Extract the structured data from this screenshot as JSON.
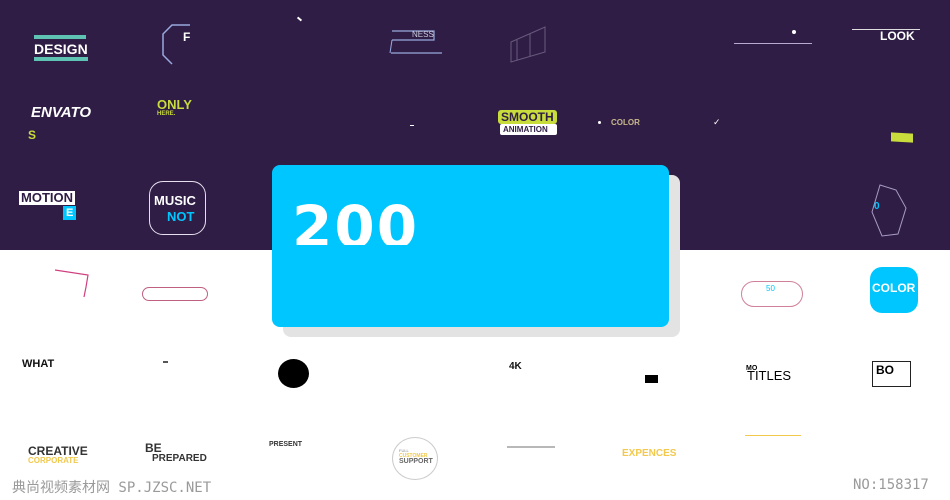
{
  "colors": {
    "background_top": "#2f1d45",
    "accent_blue": "#00c6ff",
    "accent_lime": "#c8dc3c",
    "accent_teal": "#5fc3b3",
    "accent_yellow": "#f2c94c"
  },
  "tiles_top": {
    "design": "DESIGN",
    "f": "F",
    "ness": "NESS",
    "look": "LOOK",
    "envato": "ENVATO",
    "s": "S",
    "only": "ONLY",
    "here": "HERE.",
    "smooth": "SMOOTH",
    "animation": "ANIMATION",
    "color": "COLOR",
    "motion": "MOTION",
    "e": "E",
    "music": "MUSIC",
    "not": "NOT",
    "zero": "0"
  },
  "featured_card": {
    "value": "200"
  },
  "tiles_bottom": {
    "fifty": "50",
    "color": "COLOR",
    "what": "WHAT",
    "fourk": "4K",
    "mo": "MO",
    "titles": "TITLES",
    "bo": "BO",
    "creative": "CREATIVE",
    "corporate": "CORPORATE",
    "be": "BE",
    "prepared": "PREPARED",
    "present": "PRESENT",
    "full": "FULL",
    "customer": "CUSTOMER",
    "support": "SUPPORT",
    "expences": "EXPENCES"
  },
  "watermark": {
    "left": "典尚视频素材网 SP.JZSC.NET",
    "right": "NO:158317"
  }
}
